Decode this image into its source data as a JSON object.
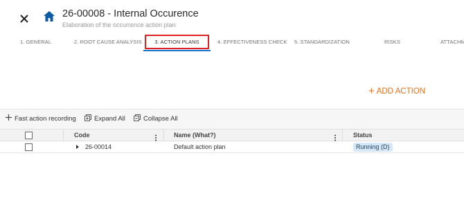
{
  "header": {
    "title": "26-00008 - Internal Occurence",
    "subtitle": "Elaboration of the occurrence action plan"
  },
  "tabs": [
    {
      "label": "1. GENERAL"
    },
    {
      "label": "2. ROOT CAUSE ANALYSIS"
    },
    {
      "label": "3. ACTION PLANS"
    },
    {
      "label": "4. EFFECTIVENESS CHECK"
    },
    {
      "label": "5. STANDARDIZATION"
    },
    {
      "label": "RISKS"
    },
    {
      "label": "ATTACHM"
    }
  ],
  "active_tab": "3. ACTION PLANS",
  "add_action_label": "ADD ACTION",
  "toolbar": {
    "fast_action_label": "Fast action recording",
    "expand_all_label": "Expand All",
    "collapse_all_label": "Collapse All"
  },
  "grid": {
    "columns": [
      "Code",
      "Name (What?)",
      "Status"
    ],
    "rows": [
      {
        "code": "26-00014",
        "name": "Default action plan",
        "status": "Running (D)"
      }
    ]
  },
  "colors": {
    "accent": "#e8701a",
    "active_tab_underline": "#1a73c8",
    "highlight_box": "#e02020",
    "home_icon": "#0d5aa7",
    "status_badge_bg": "#d6e8f7"
  },
  "icons": {
    "close": "close-icon",
    "home": "home-icon",
    "add": "plus-icon",
    "expand_all": "expand-all-icon",
    "collapse_all": "collapse-all-icon",
    "column_menu": "kebab-icon",
    "row_expand": "caret-right-icon"
  }
}
